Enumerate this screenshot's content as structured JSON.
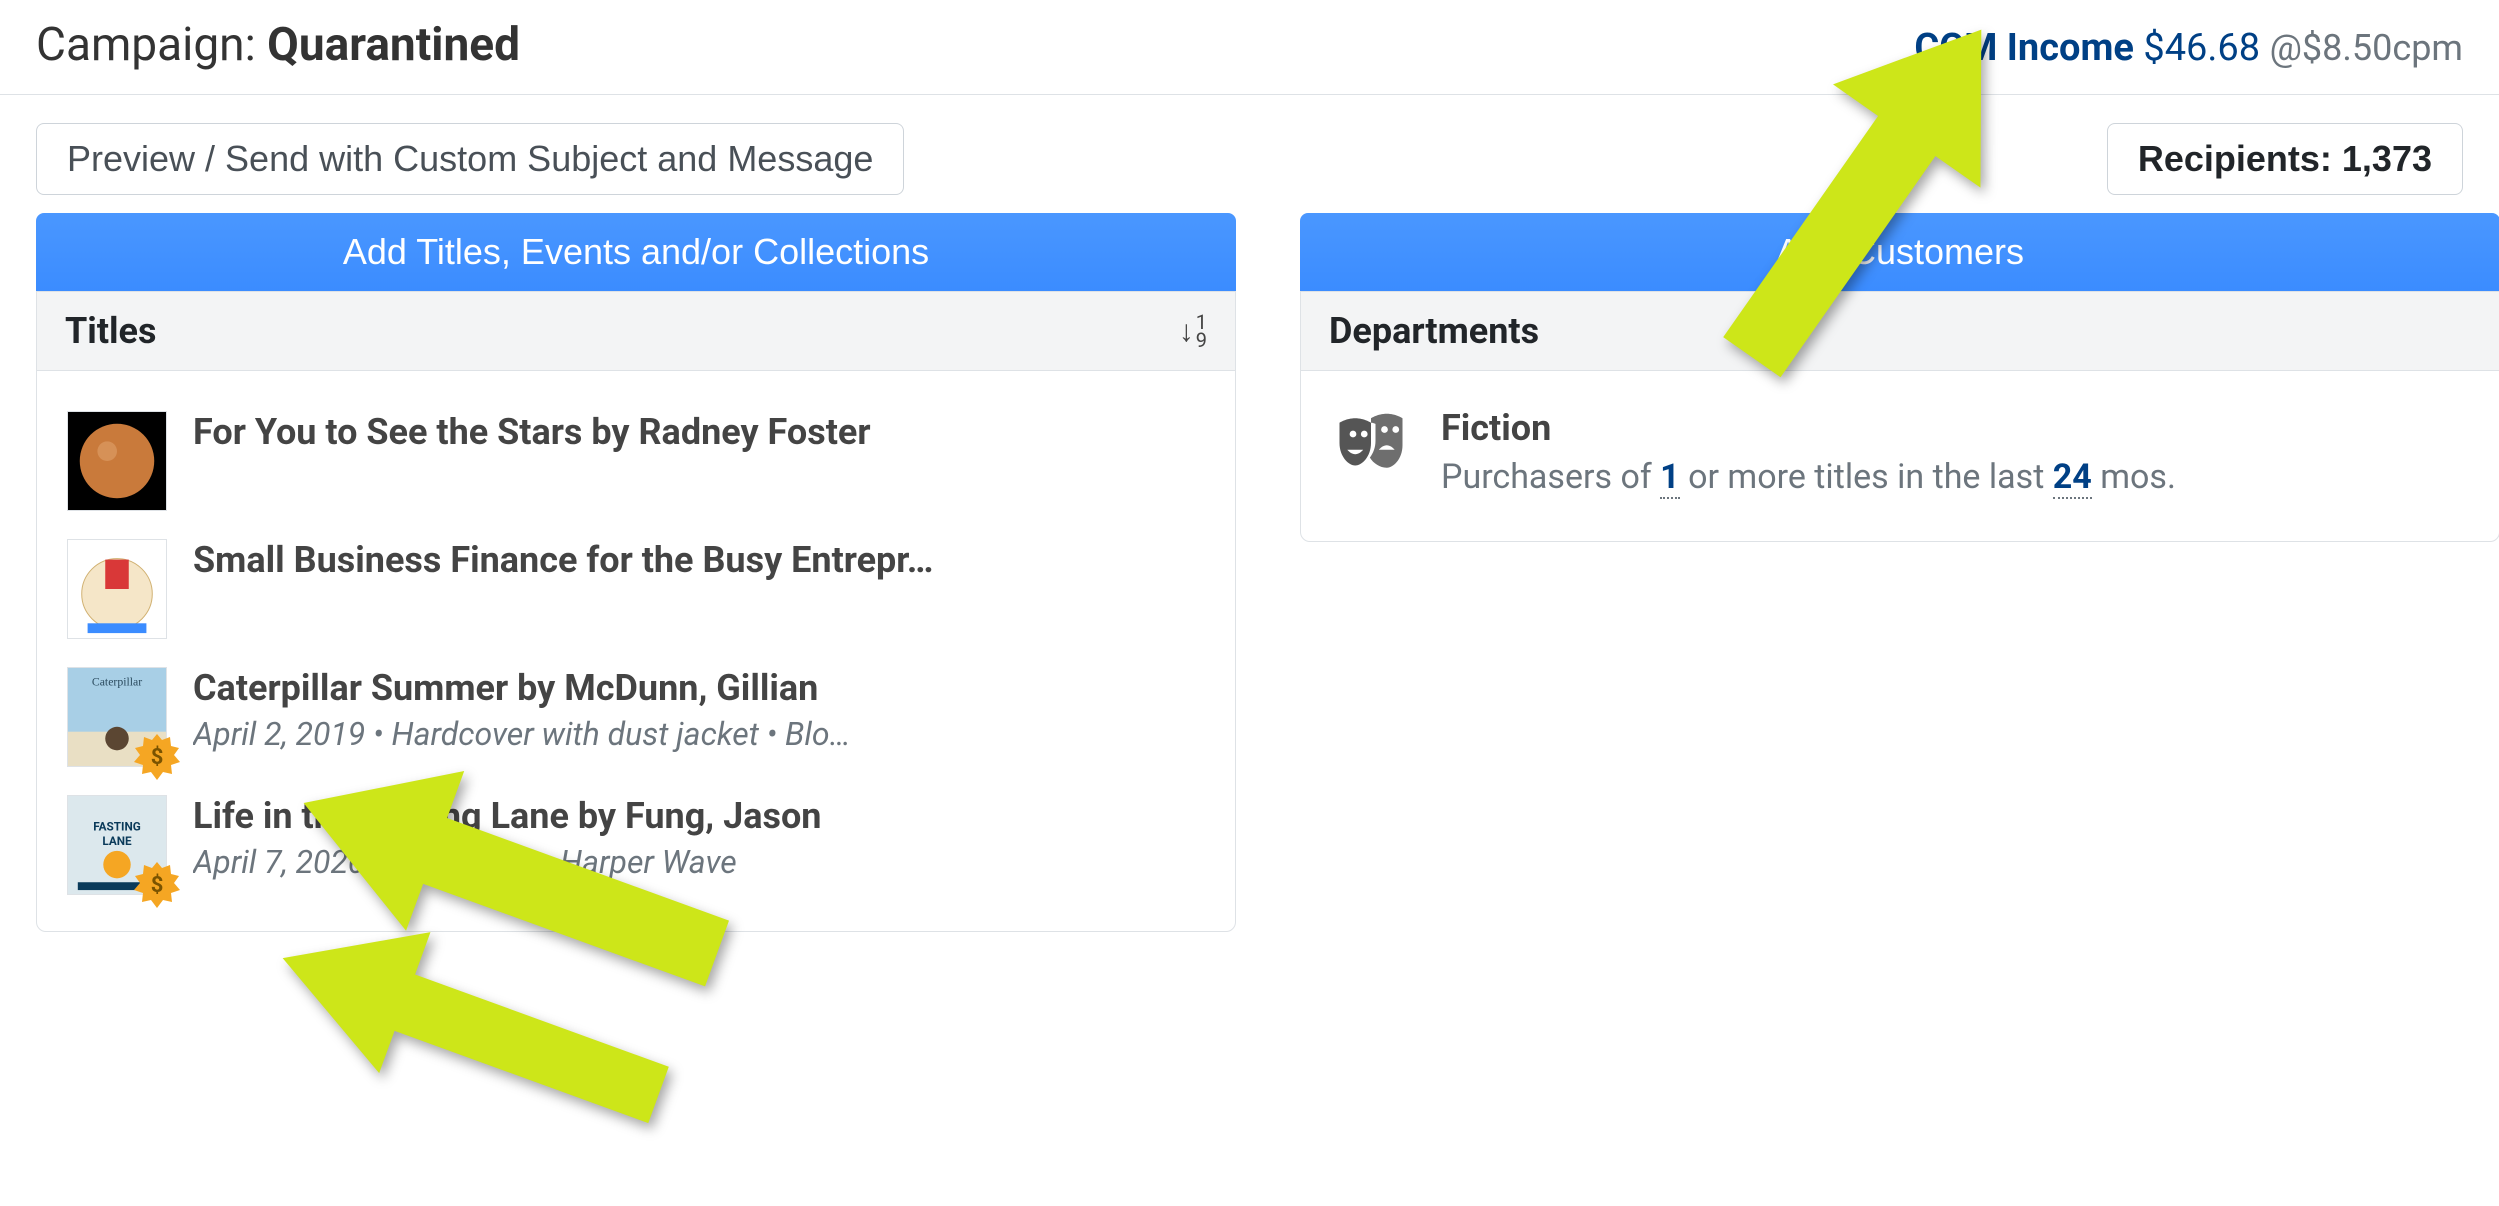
{
  "header": {
    "prefix": "Campaign: ",
    "name": "Quarantined",
    "income_label": "CCM Income",
    "income_amount": "$46.68",
    "cpm": "@$8.50cpm"
  },
  "controls": {
    "preview": "Preview / Send with Custom Subject and Message",
    "recipients_label": "Recipients: ",
    "recipients_count": "1,373"
  },
  "left": {
    "add_label": "Add Titles, Events and/or Collections",
    "panel_title": "Titles",
    "items": [
      {
        "title": "For You to See the Stars by Radney Foster",
        "meta": "",
        "badge": false,
        "thumb": "mars"
      },
      {
        "title": "Small Business Finance for the Busy Entrepr…",
        "meta": "",
        "badge": false,
        "thumb": "tortilla"
      },
      {
        "title": "Caterpillar Summer by McDunn, Gillian",
        "meta": "April 2, 2019 • Hardcover with dust jacket • Blo…",
        "badge": true,
        "thumb": "cover1"
      },
      {
        "title": "Life in the Fasting Lane by Fung, Jason",
        "meta": "April 7, 2020 • Hardcover • Harper Wave",
        "badge": true,
        "thumb": "fasting"
      }
    ]
  },
  "right": {
    "add_label": "Add Customers",
    "panel_title": "Departments",
    "dept_name": "Fiction",
    "dept_sentence_pre": "Purchasers of ",
    "dept_num1": "1",
    "dept_sentence_mid": " or more titles in the last ",
    "dept_num2": "24",
    "dept_sentence_post": " mos."
  }
}
